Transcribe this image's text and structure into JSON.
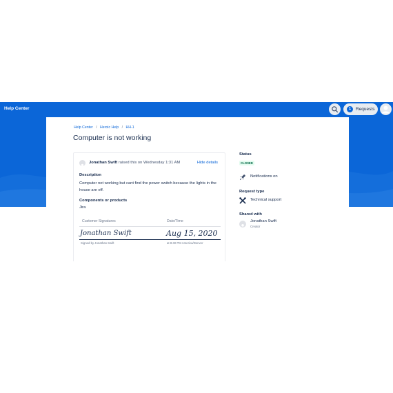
{
  "header": {
    "title": "Help Center",
    "requests_count": "1",
    "requests_label": "Requests",
    "brand_color": "#0b66d8"
  },
  "breadcrumbs": [
    {
      "label": "Help Center"
    },
    {
      "label": "Heroic Help"
    },
    {
      "label": "HH-1"
    }
  ],
  "breadcrumb_separator": "/",
  "request": {
    "title": "Computer is not working",
    "raised_by": "Jonathan Swift",
    "raised_text": "raised this on Wednesday 1:31 AM",
    "hide_details": "Hide details",
    "description_label": "Description",
    "description": "Computer not working but cant find the power switch because the lights in the house are off.",
    "components_label": "Components or products",
    "components_value": "Jira"
  },
  "signatures": {
    "col_signature": "Customer Signatures",
    "col_date": "Date/Time",
    "signature": "Jonathan Swift",
    "date": "Aug 15, 2020",
    "signed_by": "Signed by Jonathan Swift",
    "signed_at": "at 8:40 PM America/Denver"
  },
  "sidebar": {
    "status_label": "Status",
    "status_value": "CLOSED",
    "notifications": "Notifications on",
    "request_type_label": "Request type",
    "request_type_value": "Technical support",
    "shared_label": "Shared with",
    "shared_name": "Jonathan Swift",
    "shared_role": "Creator"
  },
  "icons": {
    "search": "search-icon",
    "avatar": "avatar-icon",
    "notifications": "rocket-icon",
    "request_type": "tools-icon"
  },
  "colors": {
    "status_green": "#006644",
    "link": "#0b66d8"
  }
}
